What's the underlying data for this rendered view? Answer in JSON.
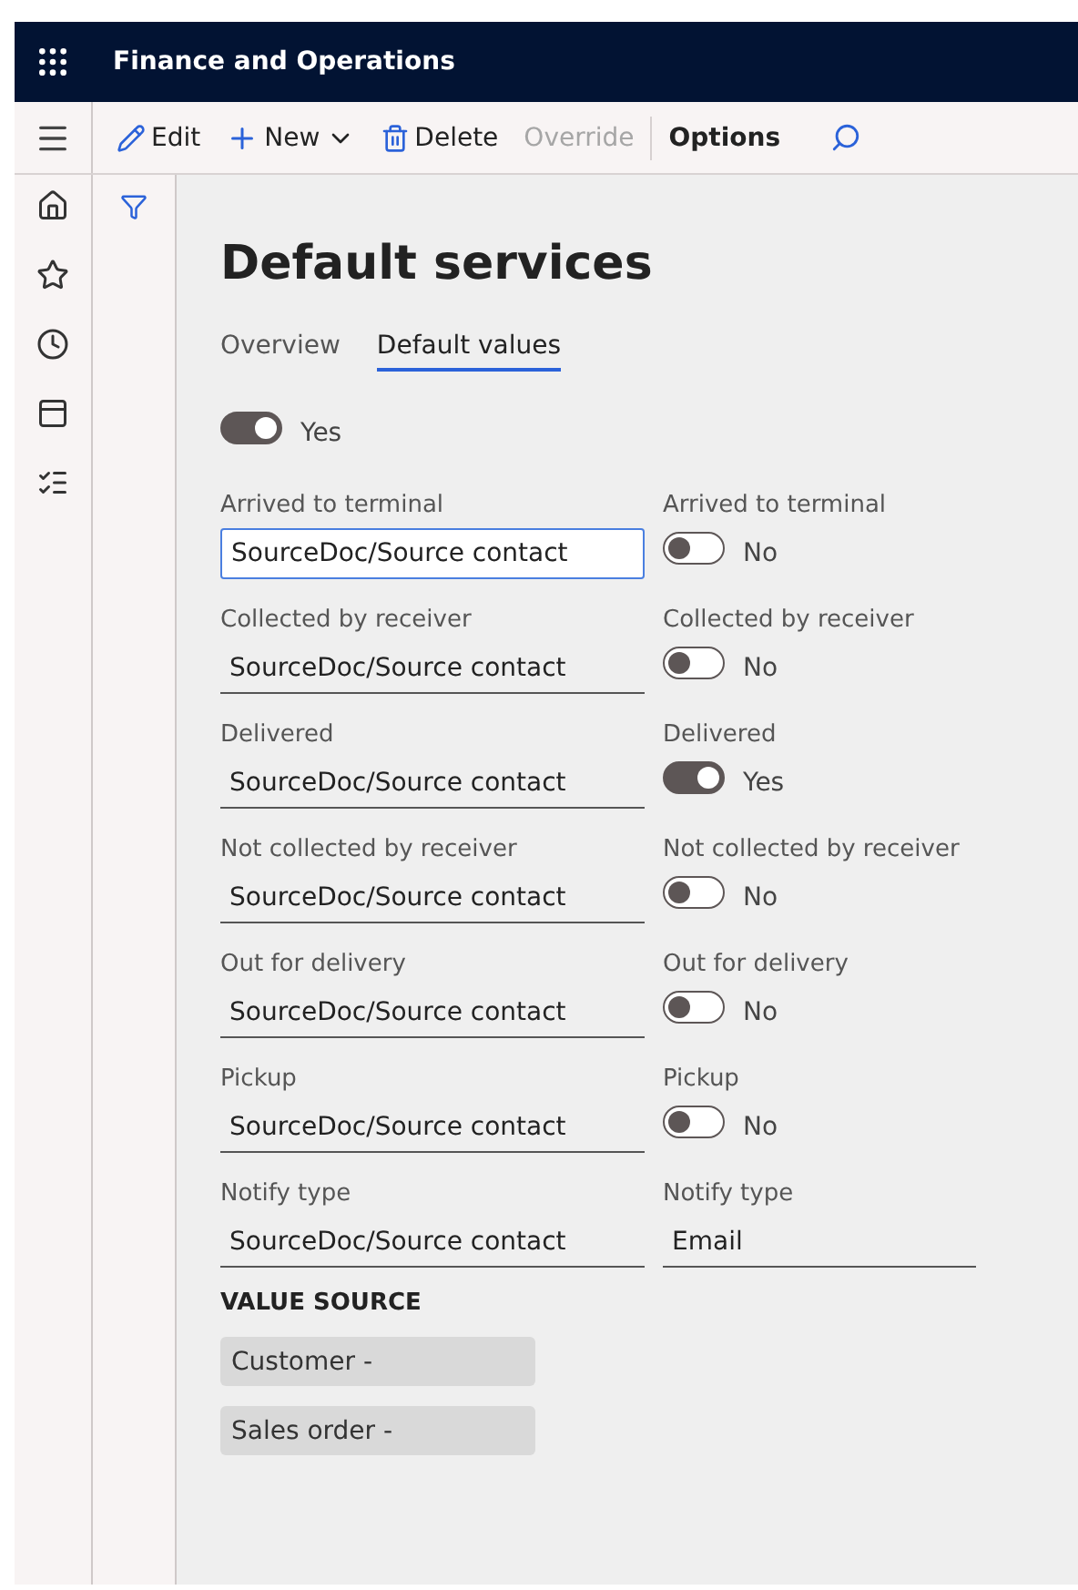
{
  "header": {
    "title": "Finance and Operations"
  },
  "toolbar": [
    {
      "kind": "edit",
      "label": "Edit",
      "disabled": false,
      "bold": false
    },
    {
      "kind": "new",
      "label": "New",
      "disabled": false,
      "bold": false
    },
    {
      "kind": "delete",
      "label": "Delete",
      "disabled": false,
      "bold": false
    },
    {
      "kind": "plain",
      "label": "Override",
      "disabled": true,
      "bold": false
    },
    {
      "kind": "plain",
      "label": "Options",
      "disabled": false,
      "bold": true
    }
  ],
  "page": {
    "title": "Default services",
    "tabs": [
      {
        "label": "Overview",
        "selected": false
      },
      {
        "label": "Default values",
        "selected": true
      }
    ],
    "master_toggle": {
      "on": true,
      "label": "Yes"
    },
    "rows": [
      {
        "left": {
          "label": "Arrived to terminal",
          "value": "SourceDoc/Source contact",
          "focused": true
        },
        "right": {
          "kind": "toggle",
          "label": "Arrived to terminal",
          "on": false,
          "value": "No"
        }
      },
      {
        "left": {
          "label": "Collected by receiver",
          "value": "SourceDoc/Source contact",
          "focused": false
        },
        "right": {
          "kind": "toggle",
          "label": "Collected by receiver",
          "on": false,
          "value": "No"
        }
      },
      {
        "left": {
          "label": "Delivered",
          "value": "SourceDoc/Source contact",
          "focused": false
        },
        "right": {
          "kind": "toggle",
          "label": "Delivered",
          "on": true,
          "value": "Yes"
        }
      },
      {
        "left": {
          "label": "Not collected by receiver",
          "value": "SourceDoc/Source contact",
          "focused": false
        },
        "right": {
          "kind": "toggle",
          "label": "Not collected by receiver",
          "on": false,
          "value": "No"
        }
      },
      {
        "left": {
          "label": "Out for delivery",
          "value": "SourceDoc/Source contact",
          "focused": false
        },
        "right": {
          "kind": "toggle",
          "label": "Out for delivery",
          "on": false,
          "value": "No"
        }
      },
      {
        "left": {
          "label": "Pickup",
          "value": "SourceDoc/Source contact",
          "focused": false
        },
        "right": {
          "kind": "toggle",
          "label": "Pickup",
          "on": false,
          "value": "No"
        }
      },
      {
        "left": {
          "label": "Notify type",
          "value": "SourceDoc/Source contact",
          "focused": false
        },
        "right": {
          "kind": "field",
          "label": "Notify type",
          "value": "Email"
        }
      }
    ],
    "value_source": {
      "heading": "VALUE SOURCE",
      "items": [
        "Customer -",
        "Sales order -"
      ]
    }
  }
}
